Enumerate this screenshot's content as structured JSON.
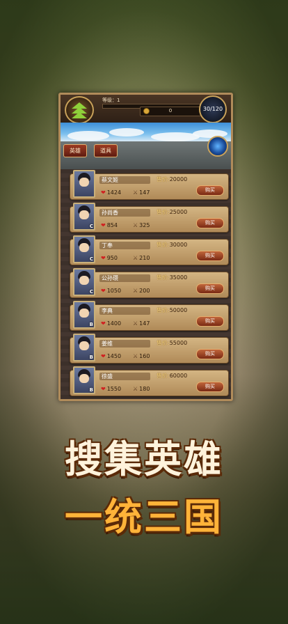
{
  "header": {
    "level_label": "等级：1",
    "coins": "0",
    "energy": "30/120"
  },
  "tabs": [
    "英雄",
    "道具"
  ],
  "heroes": [
    {
      "name": "蔡文姬",
      "price_label": "售价:",
      "price": "20000",
      "hp": "1424",
      "atk": "147",
      "grade": "",
      "buy": "购买"
    },
    {
      "name": "孙尚香",
      "price_label": "售价:",
      "price": "25000",
      "hp": "854",
      "atk": "325",
      "grade": "C",
      "buy": "购买"
    },
    {
      "name": "丁奉",
      "price_label": "售价:",
      "price": "30000",
      "hp": "950",
      "atk": "210",
      "grade": "C",
      "buy": "购买"
    },
    {
      "name": "公孙瓒",
      "price_label": "售价:",
      "price": "35000",
      "hp": "1050",
      "atk": "200",
      "grade": "C",
      "buy": "购买"
    },
    {
      "name": "李典",
      "price_label": "售价:",
      "price": "50000",
      "hp": "1400",
      "atk": "147",
      "grade": "B",
      "buy": "购买"
    },
    {
      "name": "姜维",
      "price_label": "售价:",
      "price": "55000",
      "hp": "1450",
      "atk": "160",
      "grade": "B",
      "buy": "购买"
    },
    {
      "name": "徐盛",
      "price_label": "售价:",
      "price": "60000",
      "hp": "1550",
      "atk": "180",
      "grade": "B",
      "buy": "购买"
    }
  ],
  "slogan": {
    "line1": "搜集英雄",
    "line2": "一统三国"
  },
  "icons": [
    "level-chevron-icon",
    "coin-icon",
    "energy-icon",
    "orb-icon",
    "heart-icon",
    "attack-icon"
  ]
}
